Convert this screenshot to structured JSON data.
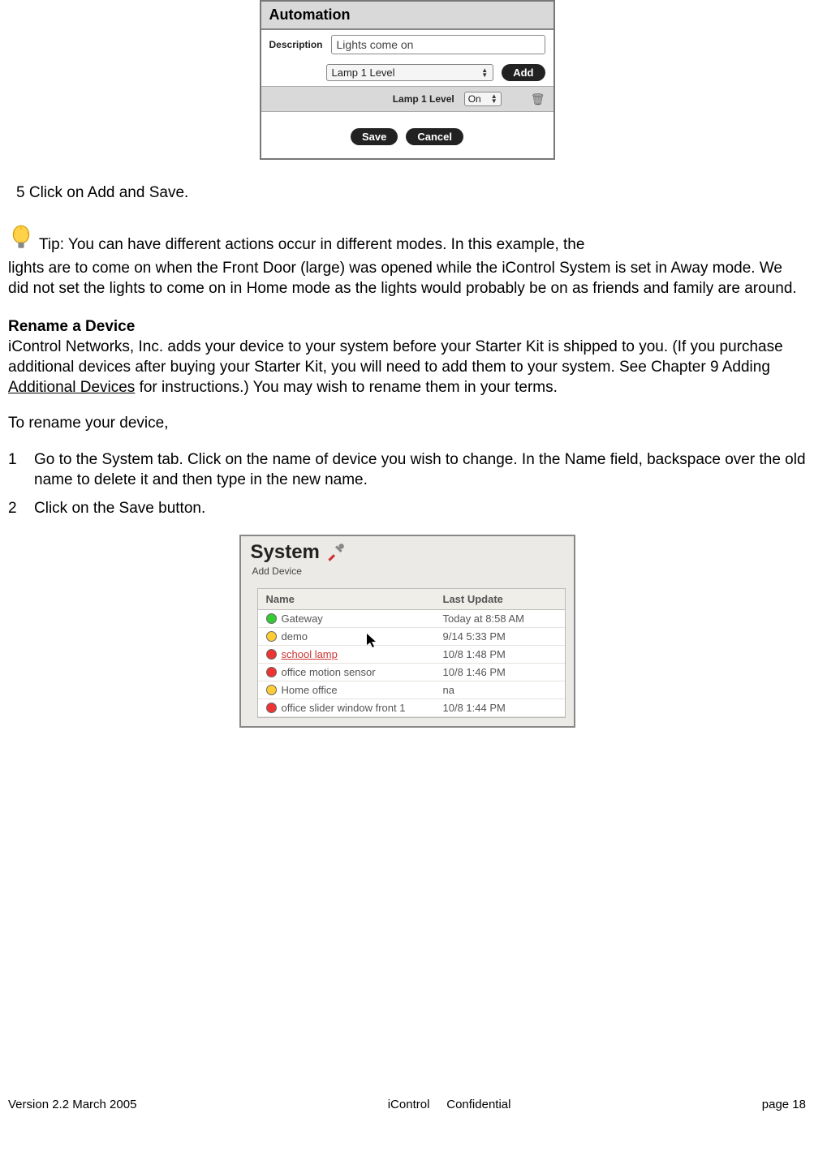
{
  "automation_panel": {
    "title": "Automation",
    "description_label": "Description",
    "description_value": "Lights come on",
    "select_value": "Lamp 1 Level",
    "add_button": "Add",
    "row_label": "Lamp 1 Level",
    "row_state": "On",
    "save_button": "Save",
    "cancel_button": "Cancel"
  },
  "step5": "5  Click on Add and Save.",
  "tip_prefix": "Tip: You can have different actions occur in different modes.  In this example, the",
  "tip_body": "lights are to come on when the Front Door (large) was opened while the iControl System is set in Away mode.   We did not set the lights to come on in Home mode as the lights would probably be on as friends and family are around.",
  "rename": {
    "title": "Rename a Device",
    "para_before": "iControl Networks, Inc. adds your device to your system before your Starter Kit is shipped to you.  (If you purchase additional devices after buying your Starter Kit, you will need to add them to your system.  See Chapter 9 Adding",
    "link": " Additional Devices",
    "para_after": " for instructions.) You may wish to rename them in your terms.",
    "lead": "To rename your device,",
    "step1": "Go to the System tab.  Click on the name of device you wish to change.  In the Name field, backspace over the old name to delete it and then type in the new name.",
    "step2": "Click on the Save button."
  },
  "system_panel": {
    "title": "System",
    "add_device": "Add Device",
    "columns": {
      "name": "Name",
      "update": "Last Update"
    },
    "rows": [
      {
        "status": "green",
        "name": "Gateway",
        "update": "Today at 8:58 AM",
        "selected": false
      },
      {
        "status": "yellow",
        "name": "demo",
        "update": "9/14 5:33 PM",
        "selected": false
      },
      {
        "status": "red",
        "name": "school lamp",
        "update": "10/8 1:48 PM",
        "selected": true
      },
      {
        "status": "red",
        "name": "office motion sensor",
        "update": "10/8 1:46 PM",
        "selected": false
      },
      {
        "status": "yellow",
        "name": "Home office",
        "update": "na",
        "selected": false
      },
      {
        "status": "red",
        "name": "office slider window front 1",
        "update": "10/8 1:44 PM",
        "selected": false
      }
    ]
  },
  "footer": {
    "left": "Version 2.2 March 2005",
    "center": "iControl     Confidential",
    "right": "page 18"
  }
}
